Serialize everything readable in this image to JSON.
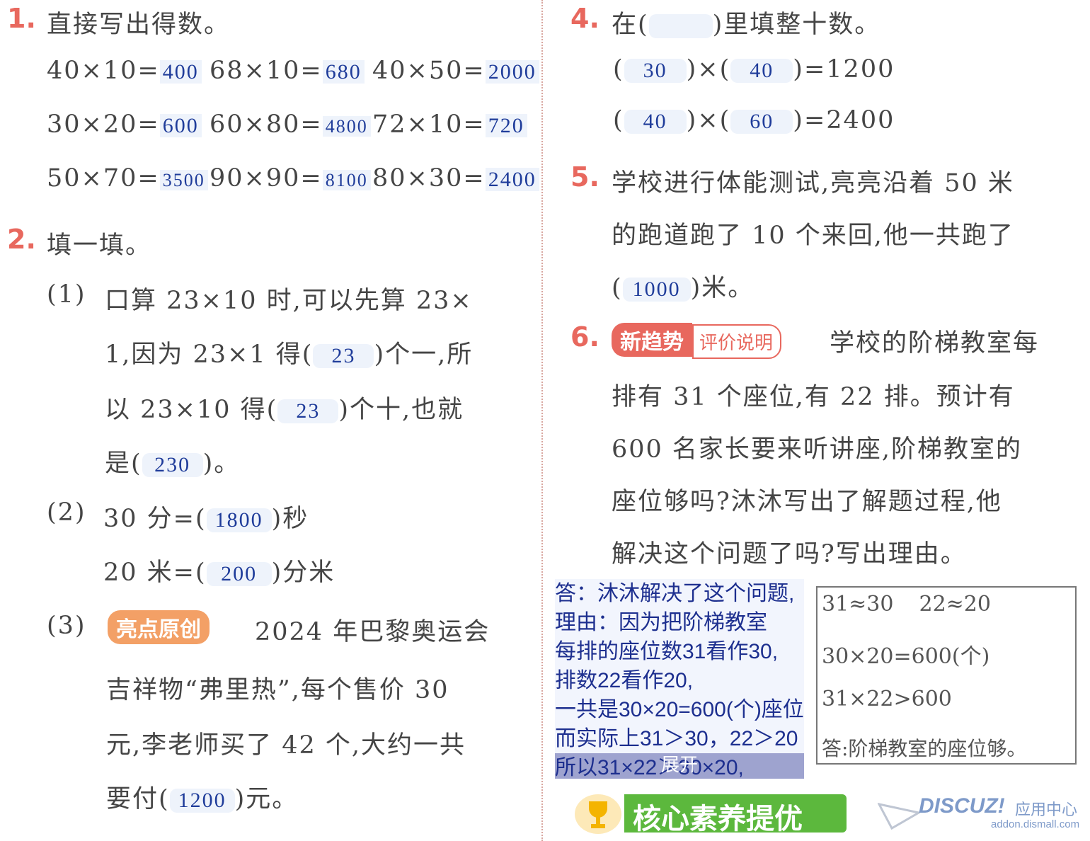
{
  "q1": {
    "num": "1.",
    "title": "直接写出得数。",
    "rows": [
      [
        {
          "expr": "40×10=",
          "ans": "400"
        },
        {
          "expr": "68×10=",
          "ans": "680"
        },
        {
          "expr": "40×50=",
          "ans": "2000"
        }
      ],
      [
        {
          "expr": "30×20=",
          "ans": "600"
        },
        {
          "expr": "60×80=",
          "ans": "4800"
        },
        {
          "expr": "72×10=",
          "ans": "720"
        }
      ],
      [
        {
          "expr": "50×70=",
          "ans": "3500"
        },
        {
          "expr": "90×90=",
          "ans": "8100"
        },
        {
          "expr": "80×30=",
          "ans": "2400"
        }
      ]
    ]
  },
  "q2": {
    "num": "2.",
    "title": "填一填。",
    "p1_label": "(1)",
    "p1_line1": "口算 23×10 时,可以先算 23×",
    "p1_line2a": "1,因为 23×1 得(",
    "p1_ans1": "23",
    "p1_line2b": ")个一,所",
    "p1_line3a": "以 23×10 得(",
    "p1_ans2": "23",
    "p1_line3b": ")个十,也就",
    "p1_line4a": "是(",
    "p1_ans3": "230",
    "p1_line4b": ")。",
    "p2_label": "(2)",
    "p2_line1a": "30 分=(",
    "p2_ans1": "1800",
    "p2_line1b": ")秒",
    "p2_line2a": "20 米=(",
    "p2_ans2": "200",
    "p2_line2b": ")分米",
    "p3_label": "(3)",
    "p3_badge": "亮点原创",
    "p3_line1": "2024 年巴黎奥运会",
    "p3_line2": "吉祥物“弗里热”,每个售价 30",
    "p3_line3": "元,李老师买了 42 个,大约一共",
    "p3_line4a": "要付(",
    "p3_ans": "1200",
    "p3_line4b": ")元。"
  },
  "q4": {
    "num": "4.",
    "title_a": "在(",
    "title_b": ")里填整十数。",
    "row1": {
      "a": "30",
      "b": "40",
      "result": ")=1200"
    },
    "row2": {
      "a": "40",
      "b": "60",
      "result": ")=2400"
    },
    "times": ")×("
  },
  "q5": {
    "num": "5.",
    "line1": "学校进行体能测试,亮亮沿着 50 米",
    "line2": "的跑道跑了 10 个来回,他一共跑了",
    "line3a": "(",
    "ans": "1000",
    "line3b": ")米。"
  },
  "q6": {
    "num": "6.",
    "badge": "新趋势",
    "badge2": "评价说明",
    "line1": "学校的阶梯教室每",
    "line2": "排有 31 个座位,有 22 排。预计有",
    "line3": "600 名家长要来听讲座,阶梯教室的",
    "line4": "座位够吗?沐沐写出了解题过程,他",
    "line5": "解决这个问题了吗?写出理由。"
  },
  "answer_panel": {
    "lines": [
      "答：沐沐解决了这个问题,",
      "理由：因为把阶梯教室",
      "每排的座位数31看作30,",
      "排数22看作20,",
      "一共是30×20=600(个)座位",
      "而实际上31＞30，22＞20",
      "所以31×22＞30×20,"
    ],
    "expand_label": "展开"
  },
  "calc_box": {
    "l1a": "31≈30",
    "l1b": "22≈20",
    "l2": "30×20=600(个)",
    "l3": "31×22>600",
    "l4": "答:阶梯教室的座位够。"
  },
  "footer": {
    "banner": "核心素养提优"
  },
  "watermark": {
    "brand": "DISCUZ!",
    "sub": "应用中心",
    "url": "addon.dismall.com"
  },
  "colors": {
    "accent": "#e8685e",
    "answer": "#1f3c9a",
    "footer_green": "#5cb83d"
  }
}
